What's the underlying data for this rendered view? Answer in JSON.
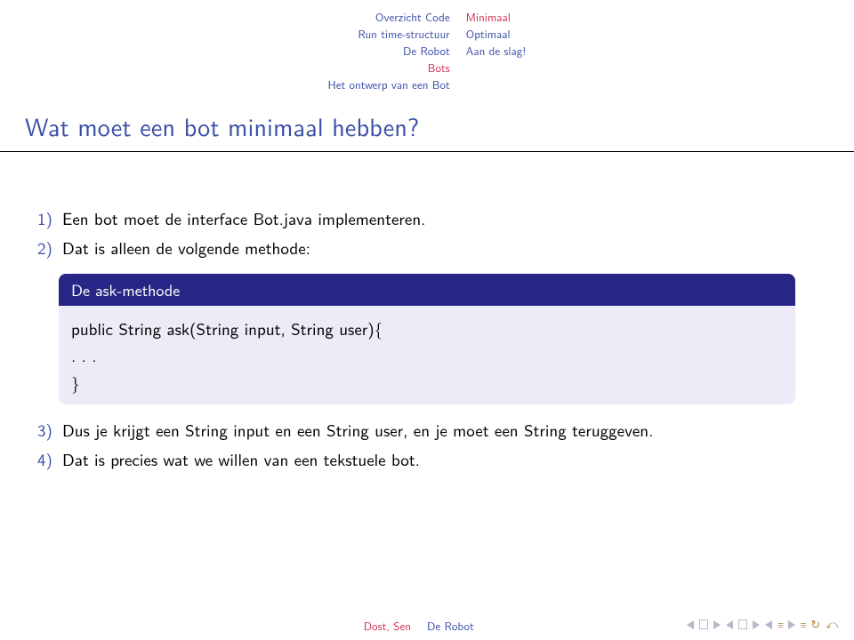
{
  "nav": {
    "left": [
      "Overzicht Code",
      "Run time-structuur",
      "De Robot",
      "Bots",
      "Het ontwerp van een Bot"
    ],
    "left_active_index": 3,
    "right": [
      "Minimaal",
      "Optimaal",
      "Aan de slag!"
    ],
    "right_active_index": 0
  },
  "title": "Wat moet een bot minimaal hebben?",
  "items": [
    {
      "n": "1)",
      "text": "Een bot moet de interface Bot.java implementeren."
    },
    {
      "n": "2)",
      "text": "Dat is alleen de volgende methode:"
    },
    {
      "n": "3)",
      "text": "Dus je krijgt een String input en een String user, en je moet een String teruggeven."
    },
    {
      "n": "4)",
      "text": "Dat is precies wat we willen van een tekstuele bot."
    }
  ],
  "block": {
    "header": "De ask-methode",
    "body_l1": "public String ask(String input, String user){",
    "body_l2": ". . .",
    "body_l3": "}"
  },
  "footer": {
    "author": "Dost, Sen",
    "title": "De Robot"
  }
}
